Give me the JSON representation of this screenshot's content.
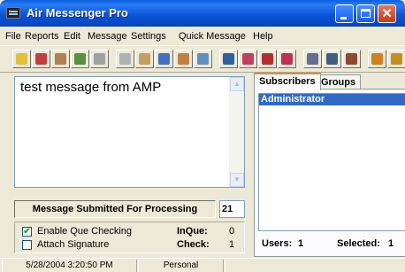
{
  "window": {
    "title": "Air Messenger Pro",
    "controls": [
      "minimize-icon",
      "maximize-icon",
      "close-icon"
    ]
  },
  "menu": {
    "items": [
      "File",
      "Reports",
      "Edit",
      "Message",
      "Settings",
      "Quick Message",
      "Help"
    ]
  },
  "toolbar": {
    "icons": [
      {
        "name": "send-icon",
        "color": "#e0c040"
      },
      {
        "name": "reply-icon",
        "color": "#c04040"
      },
      {
        "name": "edit-icon",
        "color": "#b08050"
      },
      {
        "name": "address-book-icon",
        "color": "#5a9040"
      },
      {
        "name": "disabled-icon",
        "color": "#a0a0a0"
      },
      {
        "name": "clock-icon",
        "color": "#b0b0b0"
      },
      {
        "name": "schedule-icon",
        "color": "#c0a060"
      },
      {
        "name": "calendar-icon",
        "color": "#4070c0"
      },
      {
        "name": "template-icon",
        "color": "#c08040"
      },
      {
        "name": "image-icon",
        "color": "#6090c0"
      },
      {
        "name": "spell-check-icon",
        "color": "#3060a0"
      },
      {
        "name": "find-icon",
        "color": "#c04060"
      },
      {
        "name": "print-icon",
        "color": "#b03030"
      },
      {
        "name": "print-preview-icon",
        "color": "#c03050"
      },
      {
        "name": "keyboard-icon",
        "color": "#607090"
      },
      {
        "name": "pager-icon",
        "color": "#406080"
      },
      {
        "name": "antenna-icon",
        "color": "#8a4a30"
      },
      {
        "name": "alert-icon",
        "color": "#d08020"
      },
      {
        "name": "book-icon",
        "color": "#c09020"
      }
    ]
  },
  "message": {
    "text": "test message from AMP"
  },
  "status": {
    "text": "Message Submitted For Processing",
    "count": "21"
  },
  "options": {
    "enable_que_checking": {
      "label": "Enable Que Checking",
      "checked": true
    },
    "attach_signature": {
      "label": "Attach Signature",
      "checked": false
    },
    "inque_label": "InQue:",
    "inque_value": "0",
    "check_label": "Check:",
    "check_value": "1"
  },
  "tabs": {
    "subscribers": "Subscribers",
    "groups": "Groups"
  },
  "subscribers": {
    "items": [
      "Administrator"
    ],
    "users_label": "Users:",
    "users_value": "1",
    "selected_label": "Selected:",
    "selected_value": "1"
  },
  "statusbar": {
    "datetime": "5/28/2004 3:20:50 PM",
    "profile": "Personal"
  }
}
